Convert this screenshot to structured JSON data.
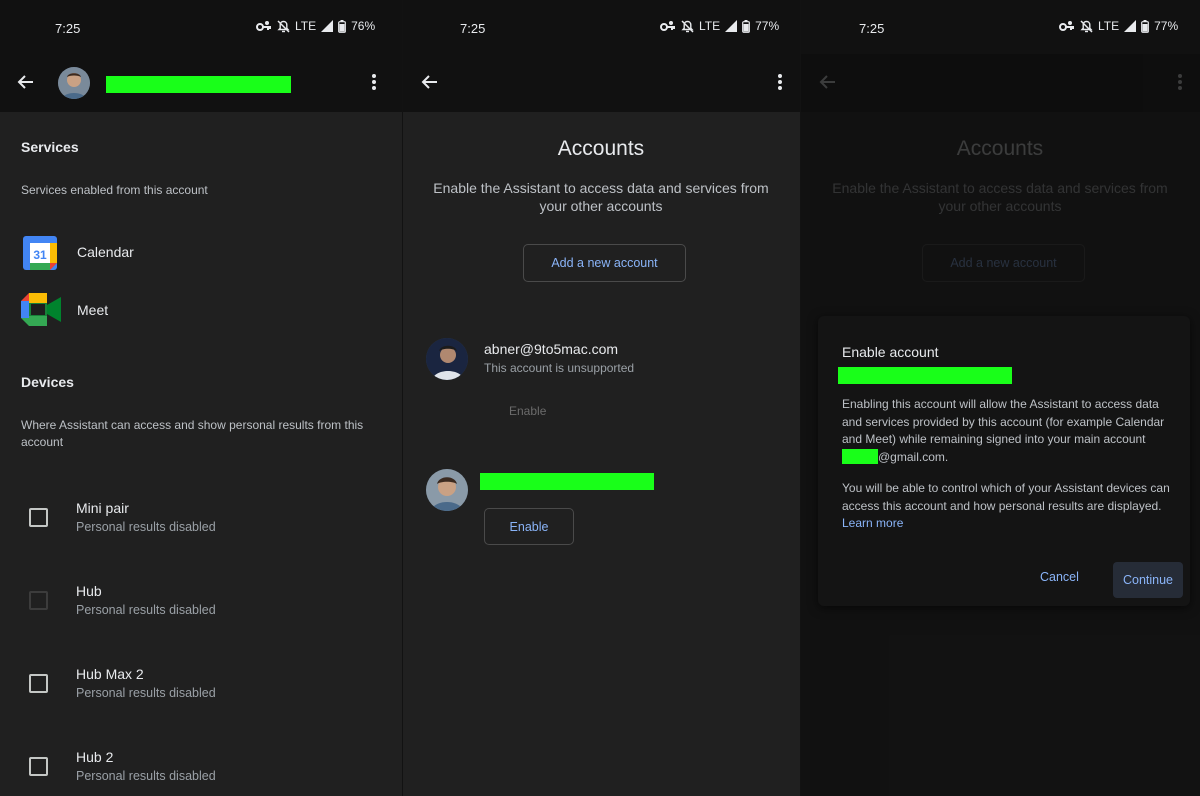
{
  "status_bars": [
    {
      "time": "7:25",
      "network": "LTE",
      "battery": "76%"
    },
    {
      "time": "7:25",
      "network": "LTE",
      "battery": "77%"
    },
    {
      "time": "7:25",
      "network": "LTE",
      "battery": "77%"
    }
  ],
  "services_screen": {
    "services_heading": "Services",
    "services_sub": "Services enabled from this account",
    "services": [
      {
        "label": "Calendar",
        "icon": "google-calendar-icon"
      },
      {
        "label": "Meet",
        "icon": "google-meet-icon"
      }
    ],
    "devices_heading": "Devices",
    "devices_sub": "Where Assistant can access and show personal results from this account",
    "devices": [
      {
        "name": "Mini pair",
        "status": "Personal results disabled"
      },
      {
        "name": "Hub",
        "status": "Personal results disabled"
      },
      {
        "name": "Hub Max 2",
        "status": "Personal results disabled"
      },
      {
        "name": "Hub 2",
        "status": "Personal results disabled"
      }
    ]
  },
  "accounts_screen": {
    "title": "Accounts",
    "description": "Enable the Assistant to access data and services from your other accounts",
    "add_account_label": "Add a new account",
    "accounts": [
      {
        "email": "abner@9to5mac.com",
        "note": "This account is unsupported",
        "enable_label": "Enable"
      },
      {
        "enable_label": "Enable"
      }
    ]
  },
  "dialog": {
    "title": "Enable account",
    "body_1_prefix": "Enabling this account will allow the Assistant to access data and services provided by this account (for example Calendar and Meet) while remaining signed into your main account ",
    "body_1_suffix": "@gmail.com.",
    "body_2": "You will be able to control which of your Assistant devices can access this account and how personal results are displayed. ",
    "learn_more": "Learn more",
    "cancel_label": "Cancel",
    "continue_label": "Continue"
  },
  "colors": {
    "accent": "#8ab4f8",
    "background": "#202020",
    "appbar": "#111111",
    "redaction": "#19ff19"
  }
}
